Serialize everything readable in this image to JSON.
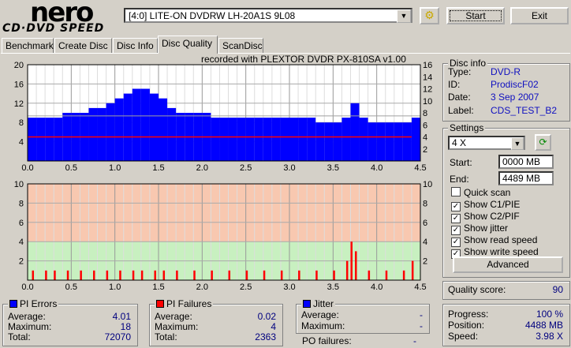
{
  "app": {
    "logo_top": "nero",
    "logo_bottom": "CD·DVD SPEED"
  },
  "toolbar": {
    "drive": "[4:0]  LITE-ON DVDRW LH-20A1S 9L08",
    "start": "Start",
    "exit": "Exit"
  },
  "tabs": [
    {
      "label": "Benchmark"
    },
    {
      "label": "Create Disc"
    },
    {
      "label": "Disc Info"
    },
    {
      "label": "Disc Quality",
      "active": true
    },
    {
      "label": "ScanDisc"
    }
  ],
  "recorded_with": "recorded with PLEXTOR DVDR   PX-810SA  v1.00",
  "disc_info": {
    "title": "Disc info",
    "type_label": "Type:",
    "type": "DVD-R",
    "id_label": "ID:",
    "id": "ProdiscF02",
    "date_label": "Date:",
    "date": "3 Sep 2007",
    "label_label": "Label:",
    "label": "CDS_TEST_B2"
  },
  "settings": {
    "title": "Settings",
    "speed": "4 X",
    "start_label": "Start:",
    "start": "0000 MB",
    "end_label": "End:",
    "end": "4489 MB",
    "options": [
      {
        "label": "Quick scan",
        "checked": false
      },
      {
        "label": "Show C1/PIE",
        "checked": true
      },
      {
        "label": "Show C2/PIF",
        "checked": true
      },
      {
        "label": "Show jitter",
        "checked": true
      },
      {
        "label": "Show read speed",
        "checked": true
      },
      {
        "label": "Show write speed",
        "checked": true
      }
    ],
    "advanced": "Advanced"
  },
  "quality": {
    "label": "Quality score:",
    "value": "90"
  },
  "pi_errors": {
    "title": "PI Errors",
    "color": "#0000ff",
    "avg_label": "Average:",
    "avg": "4.01",
    "max_label": "Maximum:",
    "max": "18",
    "total_label": "Total:",
    "total": "72070"
  },
  "pi_failures": {
    "title": "PI Failures",
    "color": "#ff0000",
    "avg_label": "Average:",
    "avg": "0.02",
    "max_label": "Maximum:",
    "max": "4",
    "total_label": "Total:",
    "total": "2363"
  },
  "jitter": {
    "title": "Jitter",
    "color": "#0000ff",
    "avg_label": "Average:",
    "avg": "-",
    "max_label": "Maximum:",
    "max": "-",
    "po_label": "PO failures:",
    "po": "-"
  },
  "progress": {
    "progress_label": "Progress:",
    "progress": "100 %",
    "position_label": "Position:",
    "position": "4488 MB",
    "speed_label": "Speed:",
    "speed": "3.98 X"
  },
  "chart_data": [
    {
      "type": "bar",
      "series_name": "PI Errors",
      "color": "#0000ff",
      "xlim": [
        0,
        4.5
      ],
      "ylim": [
        0,
        20
      ],
      "y2lim": [
        0,
        16
      ],
      "xticks": [
        "0.0",
        "0.5",
        "1.0",
        "1.5",
        "2.0",
        "2.5",
        "3.0",
        "3.5",
        "4.0",
        "4.5"
      ],
      "yticks": [
        "4",
        "8",
        "12",
        "16",
        "20"
      ],
      "y2ticks": [
        "2",
        "4",
        "6",
        "8",
        "10",
        "12",
        "14",
        "16"
      ],
      "x": [
        0.0,
        0.1,
        0.2,
        0.3,
        0.4,
        0.5,
        0.6,
        0.7,
        0.8,
        0.9,
        1.0,
        1.1,
        1.2,
        1.3,
        1.4,
        1.5,
        1.6,
        1.7,
        1.8,
        1.9,
        2.0,
        2.1,
        2.2,
        2.3,
        2.4,
        2.5,
        2.6,
        2.7,
        2.8,
        2.9,
        3.0,
        3.1,
        3.2,
        3.3,
        3.4,
        3.5,
        3.6,
        3.7,
        3.8,
        3.9,
        4.0,
        4.1,
        4.2,
        4.3,
        4.4
      ],
      "values": [
        9,
        9,
        9,
        9,
        10,
        10,
        10,
        11,
        11,
        12,
        13,
        14,
        15,
        15,
        14,
        13,
        11,
        10,
        10,
        10,
        10,
        9,
        9,
        9,
        9,
        9,
        9,
        9,
        9,
        9,
        9,
        9,
        9,
        8,
        8,
        8,
        9,
        12,
        9,
        8,
        8,
        8,
        8,
        8,
        9
      ],
      "read_speed": {
        "color": "#ff0000",
        "value": 4.0
      },
      "write_speed": {
        "color": "#a0a0a0",
        "value": 7.5
      }
    },
    {
      "type": "bar",
      "series_name": "PI Failures",
      "color": "#ff0000",
      "xlim": [
        0,
        4.5
      ],
      "ylim": [
        0,
        10
      ],
      "y2lim": [
        0,
        10
      ],
      "xticks": [
        "0.0",
        "0.5",
        "1.0",
        "1.5",
        "2.0",
        "2.5",
        "3.0",
        "3.5",
        "4.0",
        "4.5"
      ],
      "yticks": [
        "2",
        "4",
        "6",
        "8",
        "10"
      ],
      "y2ticks": [
        "2",
        "4",
        "6",
        "8",
        "10"
      ],
      "x": [
        0.05,
        0.2,
        0.3,
        0.45,
        0.6,
        0.75,
        0.9,
        1.05,
        1.2,
        1.3,
        1.45,
        1.55,
        1.7,
        1.9,
        2.1,
        2.3,
        2.5,
        2.7,
        2.9,
        3.1,
        3.3,
        3.5,
        3.65,
        3.7,
        3.75,
        3.9,
        4.1,
        4.3,
        4.4
      ],
      "values": [
        1,
        1,
        1,
        1,
        1,
        1,
        1,
        1,
        1,
        1,
        1,
        1,
        1,
        1,
        1,
        1,
        1,
        1,
        1,
        1,
        1,
        1,
        2,
        4,
        3,
        1,
        1,
        1,
        2
      ]
    }
  ]
}
